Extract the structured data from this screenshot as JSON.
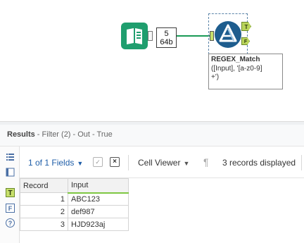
{
  "canvas": {
    "record_count": {
      "line1": "5",
      "line2": "64b"
    },
    "filter_tool": {
      "true_anchor": "T",
      "false_anchor": "F",
      "annotation_title": "REGEX_Match",
      "annotation_line2": "([Input], '[a-z0-9]",
      "annotation_line3": "+')"
    },
    "colors": {
      "connector": "#1a9a56",
      "input_tool": "#1f9e6e",
      "filter_tool": "#1e5d8e"
    }
  },
  "results": {
    "title": "Results",
    "subtitle": " - Filter (2) - Out - True",
    "toolbar": {
      "fields_label": "1 of 1 Fields",
      "cell_viewer_label": "Cell Viewer",
      "records_displayed": "3 records displayed"
    },
    "sidebar_icons": [
      "list-icon",
      "metadata-icon",
      "true-anchor-icon",
      "false-anchor-icon",
      "help-icon"
    ],
    "sidebar_labels": {
      "true": "T",
      "false": "F",
      "help": "?"
    },
    "grid": {
      "headers": [
        "Record",
        "Input"
      ],
      "rows": [
        {
          "record": "1",
          "input": "ABC123"
        },
        {
          "record": "2",
          "input": "def987"
        },
        {
          "record": "3",
          "input": "HJD923aj"
        }
      ]
    }
  }
}
